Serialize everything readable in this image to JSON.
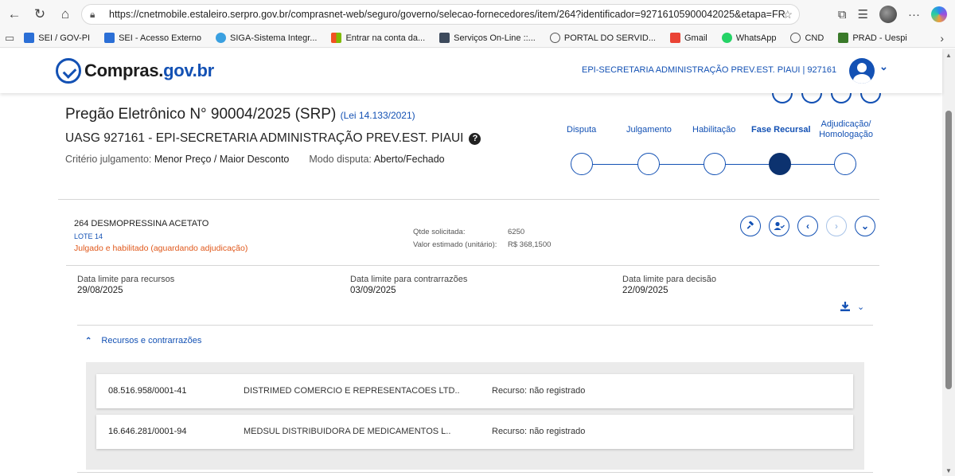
{
  "browser": {
    "url": "https://cnetmobile.estaleiro.serpro.gov.br/comprasnet-web/seguro/governo/selecao-fornecedores/item/264?identificador=92716105900042025&etapa=FR",
    "bookmarks": [
      {
        "label": "SEI / GOV-PI",
        "color": "#2b6fd6"
      },
      {
        "label": "SEI - Acesso Externo",
        "color": "#2b6fd6"
      },
      {
        "label": "SIGA-Sistema Integr...",
        "color": "#3aa0e0"
      },
      {
        "label": "Entrar na conta da...",
        "color": "#f25022"
      },
      {
        "label": "Serviços On-Line ::...",
        "color": "#3d4a5c"
      },
      {
        "label": "PORTAL DO SERVID...",
        "color": "#555555"
      },
      {
        "label": "Gmail",
        "color": "#ea4335"
      },
      {
        "label": "WhatsApp",
        "color": "#25d366"
      },
      {
        "label": "CND",
        "color": "#555555"
      },
      {
        "label": "PRAD - Uespi",
        "color": "#3a7a2a"
      }
    ]
  },
  "header": {
    "logo_main": "Compras.",
    "logo_gov": "gov.br",
    "org": "EPI-SECRETARIA ADMINISTRAÇÃO PREV.EST. PIAUI | 927161"
  },
  "pregao": {
    "title": "Pregão Eletrônico N° 90004/2025 (SRP)",
    "lei": "(Lei 14.133/2021)",
    "uasg": "UASG 927161 - EPI-SECRETARIA ADMINISTRAÇÃO PREV.EST. PIAUI",
    "criterio_label": "Critério julgamento:",
    "criterio_value": "Menor Preço / Maior Desconto",
    "modo_label": "Modo disputa:",
    "modo_value": "Aberto/Fechado"
  },
  "stepper": {
    "steps": [
      {
        "label": "Disputa"
      },
      {
        "label": "Julgamento"
      },
      {
        "label": "Habilitação"
      },
      {
        "label": "Fase Recursal",
        "active": true
      },
      {
        "label": "Adjudicação/ Homologação"
      }
    ]
  },
  "item": {
    "title": "264   DESMOPRESSINA ACETATO",
    "lote": "LOTE 14",
    "status": "Julgado e habilitado (aguardando adjudicação)",
    "qtd_label": "Qtde solicitada:",
    "qtd_value": "6250",
    "valor_label": "Valor estimado (unitário):",
    "valor_value": "R$ 368,1500"
  },
  "deadlines": [
    {
      "label": "Data limite para recursos",
      "value": "29/08/2025"
    },
    {
      "label": "Data limite para contrarrazões",
      "value": "03/09/2025"
    },
    {
      "label": "Data limite para decisão",
      "value": "22/09/2025"
    }
  ],
  "recursos": {
    "accordion_label": "Recursos e contrarrazões",
    "rows": [
      {
        "cnpj": "08.516.958/0001-41",
        "nome": "DISTRIMED COMERCIO E REPRESENTACOES LTD..",
        "recurso": "Recurso: não registrado"
      },
      {
        "cnpj": "16.646.281/0001-94",
        "nome": "MEDSUL DISTRIBUIDORA DE MEDICAMENTOS L..",
        "recurso": "Recurso: não registrado"
      }
    ]
  },
  "colors": {
    "primary": "#1351b4",
    "dark": "#0c326f",
    "warning": "#e0581b"
  }
}
